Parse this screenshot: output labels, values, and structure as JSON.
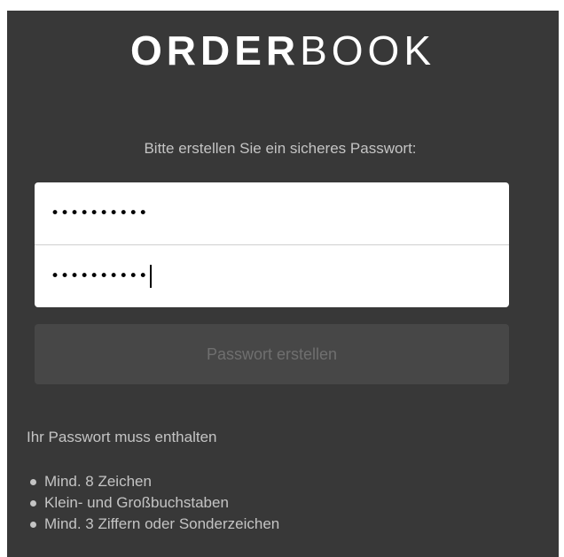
{
  "logo": {
    "bold": "ORDER",
    "light": "BOOK"
  },
  "instruction": "Bitte erstellen Sie ein sicheres Passwort:",
  "password_field": {
    "value": "••••••••••"
  },
  "confirm_field": {
    "value": "••••••••••"
  },
  "submit_label": "Passwort erstellen",
  "requirements": {
    "title": "Ihr Passwort muss enthalten",
    "items": [
      "Mind. 8 Zeichen",
      "Klein- und Großbuchstaben",
      "Mind. 3 Ziffern oder Sonderzeichen"
    ]
  },
  "colors": {
    "panel_bg": "#383838",
    "button_bg": "#474747",
    "text_muted": "#c4c4c4"
  }
}
